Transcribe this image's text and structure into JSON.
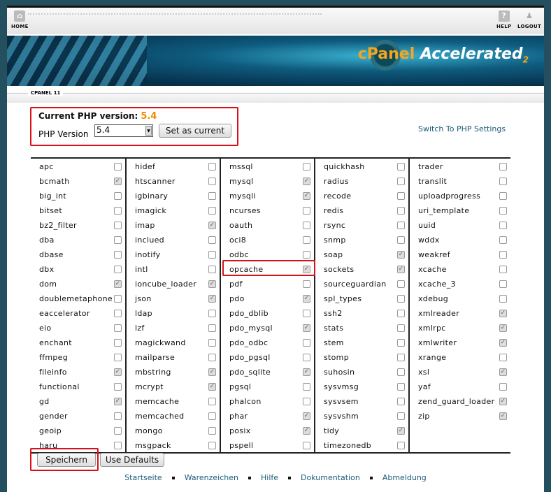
{
  "topbar": {
    "home": "HOME",
    "help": "HELP",
    "logout": "LOGOUT"
  },
  "banner": {
    "logo_cp": "cPanel",
    "logo_rest": "Accelerated",
    "logo_sub": "2"
  },
  "section": "CPANEL 11",
  "version": {
    "current_label": "Current PHP version:",
    "current_value": "5.4",
    "php_version_label": "PHP Version",
    "selected": "5.4",
    "set_button": "Set as current"
  },
  "switch_link": "Switch To PHP Settings",
  "columns": [
    [
      [
        "apc",
        0
      ],
      [
        "bcmath",
        1
      ],
      [
        "big_int",
        0
      ],
      [
        "bitset",
        0
      ],
      [
        "bz2_filter",
        0
      ],
      [
        "dba",
        0
      ],
      [
        "dbase",
        0
      ],
      [
        "dbx",
        0
      ],
      [
        "dom",
        1
      ],
      [
        "doublemetaphone",
        0
      ],
      [
        "eaccelerator",
        0
      ],
      [
        "eio",
        0
      ],
      [
        "enchant",
        0
      ],
      [
        "ffmpeg",
        0
      ],
      [
        "fileinfo",
        1
      ],
      [
        "functional",
        0
      ],
      [
        "gd",
        1
      ],
      [
        "gender",
        0
      ],
      [
        "geoip",
        0
      ],
      [
        "haru",
        0
      ]
    ],
    [
      [
        "hidef",
        0
      ],
      [
        "htscanner",
        0
      ],
      [
        "igbinary",
        0
      ],
      [
        "imagick",
        0
      ],
      [
        "imap",
        1
      ],
      [
        "inclued",
        0
      ],
      [
        "inotify",
        0
      ],
      [
        "intl",
        0
      ],
      [
        "ioncube_loader",
        1
      ],
      [
        "json",
        1
      ],
      [
        "ldap",
        0
      ],
      [
        "lzf",
        0
      ],
      [
        "magickwand",
        0
      ],
      [
        "mailparse",
        0
      ],
      [
        "mbstring",
        1
      ],
      [
        "mcrypt",
        1
      ],
      [
        "memcache",
        0
      ],
      [
        "memcached",
        0
      ],
      [
        "mongo",
        0
      ],
      [
        "msgpack",
        0
      ]
    ],
    [
      [
        "mssql",
        0
      ],
      [
        "mysql",
        1
      ],
      [
        "mysqli",
        1
      ],
      [
        "ncurses",
        0
      ],
      [
        "oauth",
        0
      ],
      [
        "oci8",
        0
      ],
      [
        "odbc",
        0
      ],
      [
        "opcache",
        1
      ],
      [
        "pdf",
        0
      ],
      [
        "pdo",
        1
      ],
      [
        "pdo_dblib",
        0
      ],
      [
        "pdo_mysql",
        1
      ],
      [
        "pdo_odbc",
        0
      ],
      [
        "pdo_pgsql",
        0
      ],
      [
        "pdo_sqlite",
        1
      ],
      [
        "pgsql",
        0
      ],
      [
        "phalcon",
        0
      ],
      [
        "phar",
        1
      ],
      [
        "posix",
        1
      ],
      [
        "pspell",
        0
      ]
    ],
    [
      [
        "quickhash",
        0
      ],
      [
        "radius",
        0
      ],
      [
        "recode",
        0
      ],
      [
        "redis",
        0
      ],
      [
        "rsync",
        0
      ],
      [
        "snmp",
        0
      ],
      [
        "soap",
        1
      ],
      [
        "sockets",
        1
      ],
      [
        "sourceguardian",
        0
      ],
      [
        "spl_types",
        0
      ],
      [
        "ssh2",
        0
      ],
      [
        "stats",
        0
      ],
      [
        "stem",
        0
      ],
      [
        "stomp",
        0
      ],
      [
        "suhosin",
        0
      ],
      [
        "sysvmsg",
        0
      ],
      [
        "sysvsem",
        0
      ],
      [
        "sysvshm",
        0
      ],
      [
        "tidy",
        1
      ],
      [
        "timezonedb",
        0
      ]
    ],
    [
      [
        "trader",
        0
      ],
      [
        "translit",
        0
      ],
      [
        "uploadprogress",
        0
      ],
      [
        "uri_template",
        0
      ],
      [
        "uuid",
        0
      ],
      [
        "wddx",
        0
      ],
      [
        "weakref",
        0
      ],
      [
        "xcache",
        0
      ],
      [
        "xcache_3",
        0
      ],
      [
        "xdebug",
        0
      ],
      [
        "xmlreader",
        1
      ],
      [
        "xmlrpc",
        1
      ],
      [
        "xmlwriter",
        1
      ],
      [
        "xrange",
        0
      ],
      [
        "xsl",
        1
      ],
      [
        "yaf",
        0
      ],
      [
        "zend_guard_loader",
        1
      ],
      [
        "zip",
        1
      ]
    ]
  ],
  "buttons": {
    "save": "Speichern",
    "defaults": "Use Defaults"
  },
  "footer": [
    "Startseite",
    "Warenzeichen",
    "Hilfe",
    "Dokumentation",
    "Abmeldung"
  ],
  "colors": {
    "highlight": "#d9101a",
    "current_version": "#f08a00",
    "link": "#1c5b7a"
  }
}
